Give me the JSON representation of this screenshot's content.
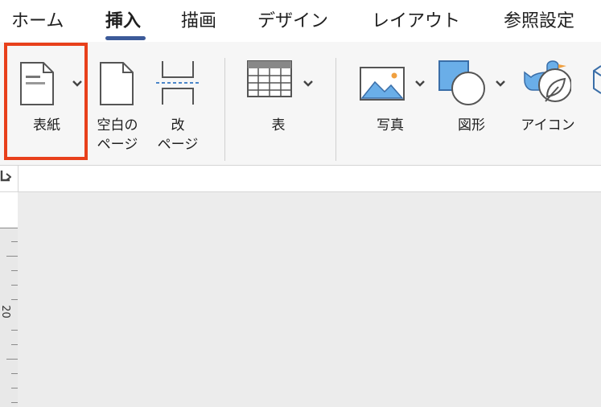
{
  "tabs": [
    {
      "label": "ホーム"
    },
    {
      "label": "挿入",
      "active": true
    },
    {
      "label": "描画"
    },
    {
      "label": "デザイン"
    },
    {
      "label": "レイアウト"
    },
    {
      "label": "参照設定"
    }
  ],
  "ribbon": {
    "cover_page": {
      "label": "表紙",
      "icon": "cover-page-icon"
    },
    "blank_page": {
      "label_line1": "空白の",
      "label_line2": "ページ",
      "icon": "blank-page-icon"
    },
    "page_break": {
      "label_line1": "改",
      "label_line2": "ページ",
      "icon": "page-break-icon"
    },
    "table": {
      "label": "表",
      "icon": "table-icon"
    },
    "pictures": {
      "label": "写真",
      "icon": "picture-icon"
    },
    "shapes": {
      "label": "図形",
      "icon": "shapes-icon"
    },
    "icons": {
      "label": "アイコン",
      "icon": "icons-icon"
    }
  },
  "ruler": {
    "vertical_number": "20"
  },
  "colors": {
    "accent_underline": "#3c5a99",
    "highlight_box": "#e8401b",
    "icon_blue": "#6aaee8",
    "ribbon_bg": "#f6f6f6",
    "workspace_bg": "#ececec"
  }
}
